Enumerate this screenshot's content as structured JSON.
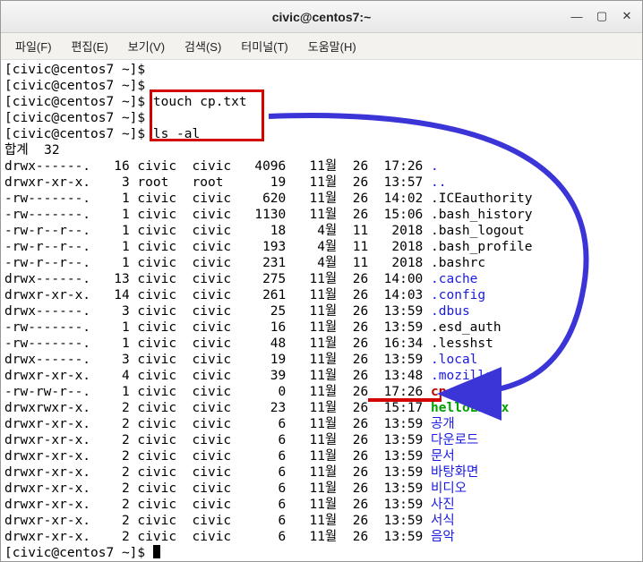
{
  "window": {
    "title": "civic@centos7:~"
  },
  "menu": {
    "file": "파일(F)",
    "edit": "편집(E)",
    "view": "보기(V)",
    "search": "검색(S)",
    "terminal": "터미널(T)",
    "help": "도움말(H)"
  },
  "prompt": "[civic@centos7 ~]$ ",
  "cmd": {
    "touch": "touch cp.txt",
    "ls": "ls -al"
  },
  "total": "합계  32",
  "rows": [
    {
      "perm": "drwx------.",
      "links": "16",
      "owner": "civic",
      "group": "civic",
      "size": "4096",
      "mon": "11월",
      "day": "26",
      "time": "17:26",
      "name": ".",
      "cls": "blue"
    },
    {
      "perm": "drwxr-xr-x.",
      "links": "3",
      "owner": "root ",
      "group": "root ",
      "size": "19",
      "mon": "11월",
      "day": "26",
      "time": "13:57",
      "name": "..",
      "cls": "blue"
    },
    {
      "perm": "-rw-------.",
      "links": "1",
      "owner": "civic",
      "group": "civic",
      "size": "620",
      "mon": "11월",
      "day": "26",
      "time": "14:02",
      "name": ".ICEauthority",
      "cls": ""
    },
    {
      "perm": "-rw-------.",
      "links": "1",
      "owner": "civic",
      "group": "civic",
      "size": "1130",
      "mon": "11월",
      "day": "26",
      "time": "15:06",
      "name": ".bash_history",
      "cls": ""
    },
    {
      "perm": "-rw-r--r--.",
      "links": "1",
      "owner": "civic",
      "group": "civic",
      "size": "18",
      "mon": "4월",
      "day": "11",
      "time": "2018",
      "name": ".bash_logout",
      "cls": ""
    },
    {
      "perm": "-rw-r--r--.",
      "links": "1",
      "owner": "civic",
      "group": "civic",
      "size": "193",
      "mon": "4월",
      "day": "11",
      "time": "2018",
      "name": ".bash_profile",
      "cls": ""
    },
    {
      "perm": "-rw-r--r--.",
      "links": "1",
      "owner": "civic",
      "group": "civic",
      "size": "231",
      "mon": "4월",
      "day": "11",
      "time": "2018",
      "name": ".bashrc",
      "cls": ""
    },
    {
      "perm": "drwx------.",
      "links": "13",
      "owner": "civic",
      "group": "civic",
      "size": "275",
      "mon": "11월",
      "day": "26",
      "time": "14:00",
      "name": ".cache",
      "cls": "blue"
    },
    {
      "perm": "drwxr-xr-x.",
      "links": "14",
      "owner": "civic",
      "group": "civic",
      "size": "261",
      "mon": "11월",
      "day": "26",
      "time": "14:03",
      "name": ".config",
      "cls": "blue"
    },
    {
      "perm": "drwx------.",
      "links": "3",
      "owner": "civic",
      "group": "civic",
      "size": "25",
      "mon": "11월",
      "day": "26",
      "time": "13:59",
      "name": ".dbus",
      "cls": "blue"
    },
    {
      "perm": "-rw-------.",
      "links": "1",
      "owner": "civic",
      "group": "civic",
      "size": "16",
      "mon": "11월",
      "day": "26",
      "time": "13:59",
      "name": ".esd_auth",
      "cls": ""
    },
    {
      "perm": "-rw-------.",
      "links": "1",
      "owner": "civic",
      "group": "civic",
      "size": "48",
      "mon": "11월",
      "day": "26",
      "time": "16:34",
      "name": ".lesshst",
      "cls": ""
    },
    {
      "perm": "drwx------.",
      "links": "3",
      "owner": "civic",
      "group": "civic",
      "size": "19",
      "mon": "11월",
      "day": "26",
      "time": "13:59",
      "name": ".local",
      "cls": "blue"
    },
    {
      "perm": "drwxr-xr-x.",
      "links": "4",
      "owner": "civic",
      "group": "civic",
      "size": "39",
      "mon": "11월",
      "day": "26",
      "time": "13:48",
      "name": ".mozilla",
      "cls": "blue"
    },
    {
      "perm": "-rw-rw-r--.",
      "links": "1",
      "owner": "civic",
      "group": "civic",
      "size": "0",
      "mon": "11월",
      "day": "26",
      "time": "17:26",
      "name": "cp.txt",
      "cls": "red-accent"
    },
    {
      "perm": "drwxrwxr-x.",
      "links": "2",
      "owner": "civic",
      "group": "civic",
      "size": "23",
      "mon": "11월",
      "day": "26",
      "time": "15:17",
      "name": "helloLinux",
      "cls": "green"
    },
    {
      "perm": "drwxr-xr-x.",
      "links": "2",
      "owner": "civic",
      "group": "civic",
      "size": "6",
      "mon": "11월",
      "day": "26",
      "time": "13:59",
      "name": "공개",
      "cls": "blue"
    },
    {
      "perm": "drwxr-xr-x.",
      "links": "2",
      "owner": "civic",
      "group": "civic",
      "size": "6",
      "mon": "11월",
      "day": "26",
      "time": "13:59",
      "name": "다운로드",
      "cls": "blue"
    },
    {
      "perm": "drwxr-xr-x.",
      "links": "2",
      "owner": "civic",
      "group": "civic",
      "size": "6",
      "mon": "11월",
      "day": "26",
      "time": "13:59",
      "name": "문서",
      "cls": "blue"
    },
    {
      "perm": "drwxr-xr-x.",
      "links": "2",
      "owner": "civic",
      "group": "civic",
      "size": "6",
      "mon": "11월",
      "day": "26",
      "time": "13:59",
      "name": "바탕화면",
      "cls": "blue"
    },
    {
      "perm": "drwxr-xr-x.",
      "links": "2",
      "owner": "civic",
      "group": "civic",
      "size": "6",
      "mon": "11월",
      "day": "26",
      "time": "13:59",
      "name": "비디오",
      "cls": "blue"
    },
    {
      "perm": "drwxr-xr-x.",
      "links": "2",
      "owner": "civic",
      "group": "civic",
      "size": "6",
      "mon": "11월",
      "day": "26",
      "time": "13:59",
      "name": "사진",
      "cls": "blue"
    },
    {
      "perm": "drwxr-xr-x.",
      "links": "2",
      "owner": "civic",
      "group": "civic",
      "size": "6",
      "mon": "11월",
      "day": "26",
      "time": "13:59",
      "name": "서식",
      "cls": "blue"
    },
    {
      "perm": "drwxr-xr-x.",
      "links": "2",
      "owner": "civic",
      "group": "civic",
      "size": "6",
      "mon": "11월",
      "day": "26",
      "time": "13:59",
      "name": "음악",
      "cls": "blue"
    }
  ]
}
